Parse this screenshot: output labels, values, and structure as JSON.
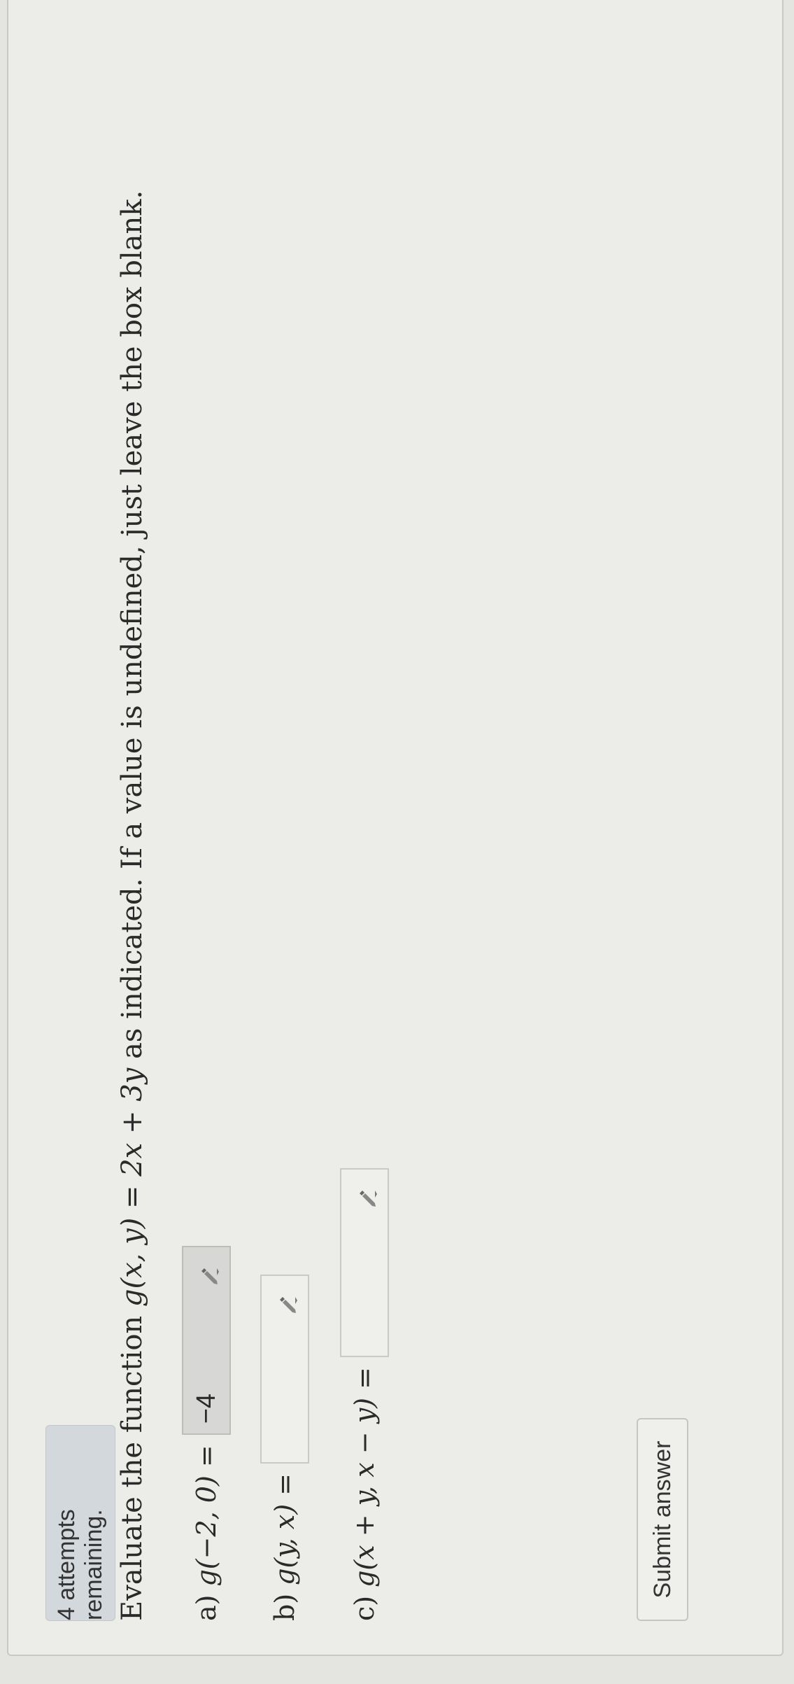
{
  "attempts": {
    "text": "4 attempts remaining."
  },
  "question": {
    "prefix": "Evaluate the function ",
    "function": "g(x, y) = 2x + 3y",
    "suffix": " as indicated. If a value is undefined, just leave the box blank."
  },
  "parts": [
    {
      "label": "a)",
      "expression": "g(−2, 0) =",
      "value": "−4",
      "icon": "pencil-icon"
    },
    {
      "label": "b)",
      "expression": "g(y, x) =",
      "value": "",
      "icon": "pencil-icon"
    },
    {
      "label": "c)",
      "expression": "g(x + y, x − y) =",
      "value": "",
      "icon": "pencil-icon"
    }
  ],
  "submit": {
    "label": "Submit answer"
  }
}
